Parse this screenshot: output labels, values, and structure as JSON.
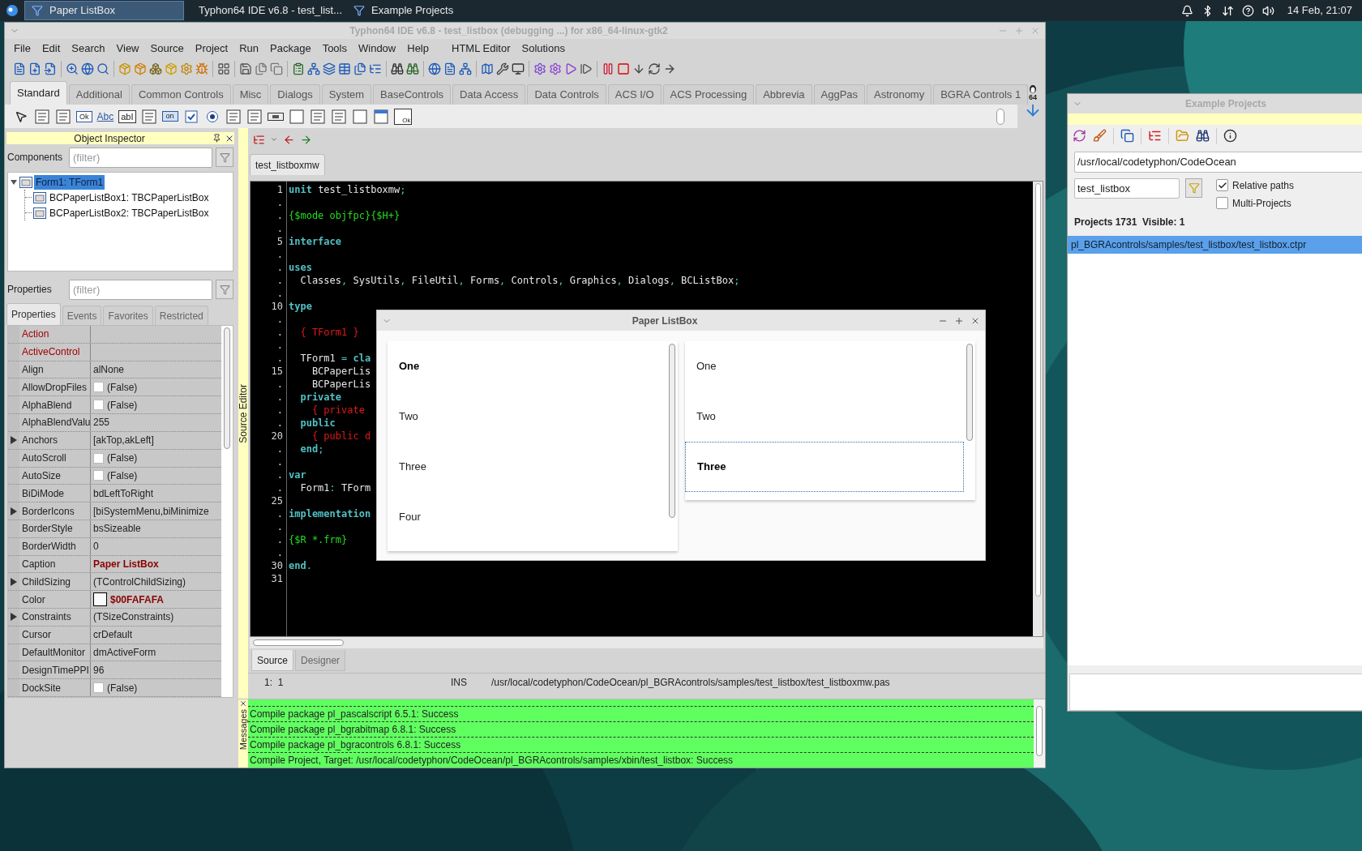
{
  "taskbar": {
    "tasks": [
      {
        "label": "Paper ListBox",
        "selected": true
      },
      {
        "label": "Typhon64 IDE v6.8 - test_list...",
        "selected": false
      },
      {
        "label": "Example Projects",
        "selected": false
      }
    ],
    "clock": "14 Feb, 21:07"
  },
  "ide": {
    "title": "Typhon64 IDE v6.8 - test_listbox (debugging ...) for x86_64-linux-gtk2",
    "menu": [
      "File",
      "Edit",
      "Search",
      "View",
      "Source",
      "Project",
      "Run",
      "Package",
      "Tools",
      "Window",
      "Help",
      "HTML Editor",
      "Solutions"
    ],
    "palette_tabs": [
      {
        "label": "Standard",
        "selected": true
      },
      {
        "label": "Additional",
        "selected": false
      },
      {
        "label": "Common Controls",
        "selected": false
      },
      {
        "label": "Misc",
        "selected": false
      },
      {
        "label": "Dialogs",
        "selected": false
      },
      {
        "label": "System",
        "selected": false
      },
      {
        "label": "BaseControls",
        "selected": false
      },
      {
        "label": "Data Access",
        "selected": false
      },
      {
        "label": "Data Controls",
        "selected": false
      },
      {
        "label": "ACS I/O",
        "selected": false
      },
      {
        "label": "ACS Processing",
        "selected": false
      },
      {
        "label": "Abbrevia",
        "selected": false
      },
      {
        "label": "AggPas",
        "selected": false
      },
      {
        "label": "Astronomy",
        "selected": false
      },
      {
        "label": "BGRA Controls 1",
        "selected": false
      }
    ],
    "palette_badge": "64",
    "component_palette": [
      {
        "kind": "pointer"
      },
      {
        "kind": "menu"
      },
      {
        "kind": "popup"
      },
      {
        "kind": "button",
        "text": "Ok"
      },
      {
        "kind": "label",
        "text": "Abc"
      },
      {
        "kind": "edit",
        "text": "abI"
      },
      {
        "kind": "memo"
      },
      {
        "kind": "toggle",
        "text": "on"
      },
      {
        "kind": "checkbox"
      },
      {
        "kind": "radio"
      },
      {
        "kind": "listbox"
      },
      {
        "kind": "memo"
      },
      {
        "kind": "scrollbar"
      },
      {
        "kind": "page"
      },
      {
        "kind": "listbox"
      },
      {
        "kind": "checkgroup"
      },
      {
        "kind": "panel"
      },
      {
        "kind": "window"
      },
      {
        "kind": "grid",
        "text": "Ok"
      }
    ]
  },
  "object_inspector": {
    "title": "Object Inspector",
    "components_label": "Components",
    "components_filter": {
      "placeholder": "(filter)"
    },
    "tree": [
      {
        "label": "Form1: TForm1",
        "selected": true,
        "expanded": true,
        "children": [
          {
            "label": "BCPaperListBox1: TBCPaperListBox",
            "selected": false
          },
          {
            "label": "BCPaperListBox2: TBCPaperListBox",
            "selected": false
          }
        ]
      }
    ],
    "properties_label": "Properties",
    "properties_filter": {
      "placeholder": "(filter)"
    },
    "tabs": [
      {
        "label": "Properties",
        "selected": true
      },
      {
        "label": "Events",
        "selected": false
      },
      {
        "label": "Favorites",
        "selected": false
      },
      {
        "label": "Restricted",
        "selected": false
      }
    ],
    "properties": [
      {
        "name": "Action",
        "kind": "text",
        "emphasized": true,
        "expandable": false
      },
      {
        "name": "ActiveControl",
        "kind": "text",
        "emphasized": true,
        "expandable": false
      },
      {
        "name": "Align",
        "value": "alNone",
        "kind": "text",
        "emphasized": false,
        "expandable": false
      },
      {
        "name": "AllowDropFiles",
        "value": "(False)",
        "kind": "checkbox",
        "checked": false,
        "emphasized": false,
        "expandable": false
      },
      {
        "name": "AlphaBlend",
        "value": "(False)",
        "kind": "checkbox",
        "checked": false,
        "emphasized": false,
        "expandable": false
      },
      {
        "name": "AlphaBlendValu",
        "value": "255",
        "kind": "text",
        "emphasized": false,
        "expandable": false
      },
      {
        "name": "Anchors",
        "value": "[akTop,akLeft]",
        "kind": "text",
        "emphasized": false,
        "expandable": true
      },
      {
        "name": "AutoScroll",
        "value": "(False)",
        "kind": "checkbox",
        "checked": false,
        "emphasized": false,
        "expandable": false
      },
      {
        "name": "AutoSize",
        "value": "(False)",
        "kind": "checkbox",
        "checked": false,
        "emphasized": false,
        "expandable": false
      },
      {
        "name": "BiDiMode",
        "value": "bdLeftToRight",
        "kind": "text",
        "emphasized": false,
        "expandable": false
      },
      {
        "name": "BorderIcons",
        "value": "[biSystemMenu,biMinimize",
        "kind": "text",
        "emphasized": false,
        "expandable": true
      },
      {
        "name": "BorderStyle",
        "value": "bsSizeable",
        "kind": "text",
        "emphasized": false,
        "expandable": false
      },
      {
        "name": "BorderWidth",
        "value": "0",
        "kind": "text",
        "emphasized": false,
        "expandable": false
      },
      {
        "name": "Caption",
        "value": "Paper ListBox",
        "kind": "modified",
        "emphasized": false,
        "expandable": false
      },
      {
        "name": "ChildSizing",
        "value": "(TControlChildSizing)",
        "kind": "text",
        "emphasized": false,
        "expandable": true
      },
      {
        "name": "Color",
        "value": "$00FAFAFA",
        "kind": "color",
        "color": "#fafafa",
        "emphasized": false,
        "expandable": false
      },
      {
        "name": "Constraints",
        "value": "(TSizeConstraints)",
        "kind": "text",
        "emphasized": false,
        "expandable": true
      },
      {
        "name": "Cursor",
        "value": "crDefault",
        "kind": "text",
        "emphasized": false,
        "expandable": false
      },
      {
        "name": "DefaultMonitor",
        "value": "dmActiveForm",
        "kind": "text",
        "emphasized": false,
        "expandable": false
      },
      {
        "name": "DesignTimePPI",
        "value": "96",
        "kind": "text",
        "emphasized": false,
        "expandable": false
      },
      {
        "name": "DockSite",
        "value": "(False)",
        "kind": "checkbox",
        "checked": false,
        "emphasized": false,
        "expandable": false
      }
    ]
  },
  "source_editor": {
    "side_label": "Source Editor",
    "file_tab": "test_listboxmw",
    "lines": [
      {
        "number": "1",
        "tokens": [
          {
            "kind": "keyword",
            "text": "unit"
          },
          {
            "kind": "plain",
            "text": " test_listboxmw"
          },
          {
            "kind": "symbol",
            "text": ";"
          }
        ]
      },
      {
        "number": "."
      },
      {
        "number": ".",
        "tokens": [
          {
            "kind": "directive",
            "text": "{$mode objfpc}{$H+}"
          }
        ]
      },
      {
        "number": "."
      },
      {
        "number": "5",
        "tokens": [
          {
            "kind": "keyword",
            "text": "interface"
          }
        ]
      },
      {
        "number": "."
      },
      {
        "number": ".",
        "tokens": [
          {
            "kind": "keyword",
            "text": "uses"
          }
        ]
      },
      {
        "number": ".",
        "tokens": [
          {
            "kind": "plain",
            "text": "  Classes"
          },
          {
            "kind": "symbol",
            "text": ", "
          },
          {
            "kind": "plain",
            "text": "SysUtils"
          },
          {
            "kind": "symbol",
            "text": ", "
          },
          {
            "kind": "plain",
            "text": "FileUtil"
          },
          {
            "kind": "symbol",
            "text": ", "
          },
          {
            "kind": "plain",
            "text": "Forms"
          },
          {
            "kind": "symbol",
            "text": ", "
          },
          {
            "kind": "plain",
            "text": "Controls"
          },
          {
            "kind": "symbol",
            "text": ", "
          },
          {
            "kind": "plain",
            "text": "Graphics"
          },
          {
            "kind": "symbol",
            "text": ", "
          },
          {
            "kind": "plain",
            "text": "Dialogs"
          },
          {
            "kind": "symbol",
            "text": ", "
          },
          {
            "kind": "plain",
            "text": "BCListBox"
          },
          {
            "kind": "symbol",
            "text": ";"
          }
        ]
      },
      {
        "number": "."
      },
      {
        "number": "10",
        "tokens": [
          {
            "kind": "keyword",
            "text": "type"
          }
        ]
      },
      {
        "number": "."
      },
      {
        "number": ".",
        "tokens": [
          {
            "kind": "comment",
            "text": "  { TForm1 }"
          }
        ]
      },
      {
        "number": "."
      },
      {
        "number": ".",
        "tokens": [
          {
            "kind": "plain",
            "text": "  TForm1 "
          },
          {
            "kind": "symbol",
            "text": "= "
          },
          {
            "kind": "keyword",
            "text": "cla"
          }
        ]
      },
      {
        "number": "15",
        "tokens": [
          {
            "kind": "plain",
            "text": "    BCPaperLis"
          }
        ]
      },
      {
        "number": ".",
        "tokens": [
          {
            "kind": "plain",
            "text": "    BCPaperLis"
          }
        ]
      },
      {
        "number": ".",
        "tokens": [
          {
            "kind": "keyword",
            "text": "  private"
          }
        ]
      },
      {
        "number": ".",
        "tokens": [
          {
            "kind": "comment",
            "text": "    { private"
          }
        ]
      },
      {
        "number": ".",
        "tokens": [
          {
            "kind": "keyword",
            "text": "  public"
          }
        ]
      },
      {
        "number": "20",
        "tokens": [
          {
            "kind": "comment",
            "text": "    { public d"
          }
        ]
      },
      {
        "number": ".",
        "tokens": [
          {
            "kind": "keyword",
            "text": "  end"
          },
          {
            "kind": "symbol",
            "text": ";"
          }
        ]
      },
      {
        "number": "."
      },
      {
        "number": ".",
        "tokens": [
          {
            "kind": "keyword",
            "text": "var"
          }
        ]
      },
      {
        "number": ".",
        "tokens": [
          {
            "kind": "plain",
            "text": "  Form1"
          },
          {
            "kind": "symbol",
            "text": ": "
          },
          {
            "kind": "plain",
            "text": "TForm"
          }
        ]
      },
      {
        "number": "25"
      },
      {
        "number": ".",
        "tokens": [
          {
            "kind": "keyword",
            "text": "implementation"
          }
        ]
      },
      {
        "number": "."
      },
      {
        "number": ".",
        "tokens": [
          {
            "kind": "directive",
            "text": "{$R *.frm}"
          }
        ]
      },
      {
        "number": "."
      },
      {
        "number": "30",
        "tokens": [
          {
            "kind": "keyword",
            "text": "end"
          },
          {
            "kind": "symbol",
            "text": "."
          }
        ]
      },
      {
        "number": "31"
      }
    ],
    "view_tabs": [
      {
        "label": "Source",
        "selected": true
      },
      {
        "label": "Designer",
        "selected": false
      }
    ],
    "status": {
      "position": "1:  1",
      "mode": "INS",
      "path": "/usr/local/codetyphon/CodeOcean/pl_BGRAcontrols/samples/test_listbox/test_listboxmw.pas"
    }
  },
  "messages": {
    "side_label": "Messages",
    "lines": [
      "Compile package pl_pascalscript 6.5.1: Success",
      "Compile package pl_bgrabitmap 6.8.1: Success",
      "Compile package pl_bgracontrols 6.8.1: Success",
      "Compile Project, Target: /usr/local/codetyphon/CodeOcean/pl_BGRAcontrols/samples/xbin/test_listbox: Success"
    ]
  },
  "paper_listbox": {
    "title": "Paper ListBox",
    "lists": [
      {
        "items": [
          {
            "label": "One",
            "selected": true,
            "focused": false
          },
          {
            "label": "Two",
            "selected": false,
            "focused": false
          },
          {
            "label": "Three",
            "selected": false,
            "focused": false
          },
          {
            "label": "Four",
            "selected": false,
            "focused": false
          }
        ]
      },
      {
        "items": [
          {
            "label": "One",
            "selected": false,
            "focused": false
          },
          {
            "label": "Two",
            "selected": false,
            "focused": false
          },
          {
            "label": "Three",
            "selected": true,
            "focused": true
          }
        ]
      }
    ]
  },
  "example_projects": {
    "title": "Example Projects",
    "path": "/usr/local/codetyphon/CodeOcean",
    "filter": "test_listbox",
    "options": [
      {
        "label": "Relative paths",
        "checked": true
      },
      {
        "label": "Multi-Projects",
        "checked": false
      }
    ],
    "summary": "Projects 1731  Visible: 1",
    "projects": [
      {
        "label": "pl_BGRAcontrols/samples/test_listbox/test_listbox.ctpr",
        "selected": true
      }
    ]
  }
}
